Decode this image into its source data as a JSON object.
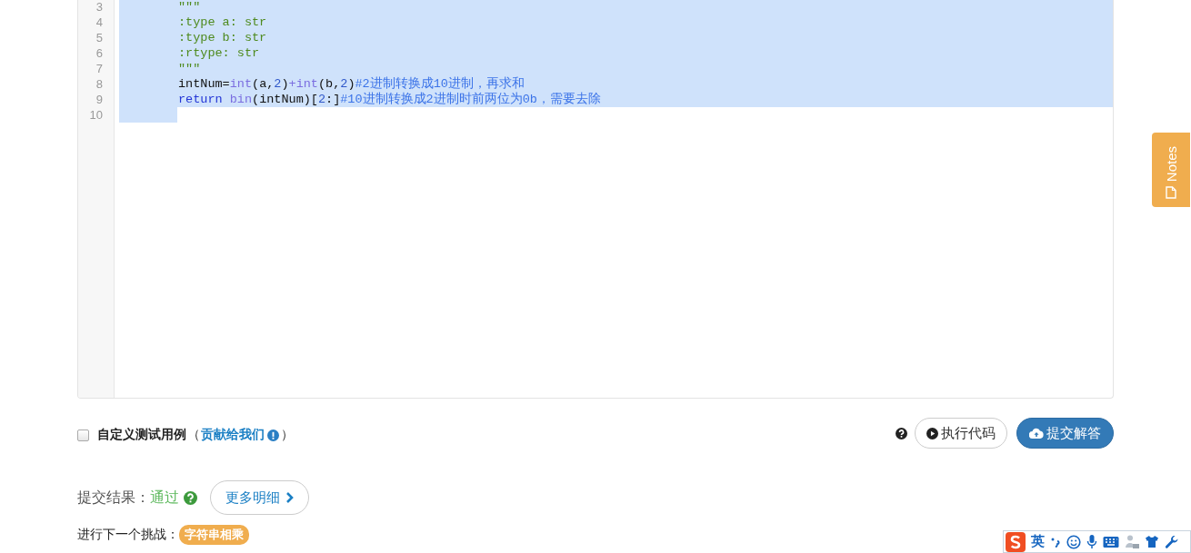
{
  "editor": {
    "lines": [
      {
        "number": "3",
        "selected": true,
        "tokens": [
          {
            "kind": "string",
            "text": "\"\"\""
          }
        ]
      },
      {
        "number": "4",
        "selected": true,
        "tokens": [
          {
            "kind": "string",
            "text": ":type a: str"
          }
        ]
      },
      {
        "number": "5",
        "selected": true,
        "tokens": [
          {
            "kind": "string",
            "text": ":type b: str"
          }
        ]
      },
      {
        "number": "6",
        "selected": true,
        "tokens": [
          {
            "kind": "string",
            "text": ":rtype: str"
          }
        ]
      },
      {
        "number": "7",
        "selected": true,
        "tokens": [
          {
            "kind": "string",
            "text": "\"\"\""
          }
        ]
      },
      {
        "number": "8",
        "selected": true,
        "tokens": [
          {
            "kind": "plain",
            "text": "intNum="
          },
          {
            "kind": "builtin",
            "text": "int"
          },
          {
            "kind": "plain",
            "text": "(a,"
          },
          {
            "kind": "number",
            "text": "2"
          },
          {
            "kind": "plain",
            "text": ")"
          },
          {
            "kind": "operator",
            "text": "+"
          },
          {
            "kind": "builtin",
            "text": "int"
          },
          {
            "kind": "plain",
            "text": "(b,"
          },
          {
            "kind": "number",
            "text": "2"
          },
          {
            "kind": "plain",
            "text": ")"
          },
          {
            "kind": "comment",
            "text": "#2进制转换成10进制，再求和"
          }
        ]
      },
      {
        "number": "9",
        "selected": true,
        "tokens": [
          {
            "kind": "keyword",
            "text": "return"
          },
          {
            "kind": "builtin",
            "text": "bin",
            "space_before": true
          },
          {
            "kind": "plain",
            "text": "(intNum)["
          },
          {
            "kind": "number",
            "text": "2"
          },
          {
            "kind": "plain",
            "text": ":]"
          },
          {
            "kind": "comment",
            "text": "#10进制转换成2进制时前两位为0b，需要去除"
          }
        ]
      },
      {
        "number": "10",
        "selected": true
      }
    ]
  },
  "custom_test": {
    "checked": false,
    "label": "自定义测试用例",
    "paren_open": "（",
    "link": "贡献给我们",
    "paren_close": "）"
  },
  "run_button": "执行代码",
  "submit_button": "提交解答",
  "result": {
    "label": "提交结果：",
    "status": "通过",
    "passed": true,
    "details_button": "更多明细"
  },
  "next": {
    "label": "进行下一个挑战：",
    "badge": "字符串相乘"
  },
  "notes_tab": "Notes",
  "ime_toolbar": {
    "mode": "英"
  }
}
